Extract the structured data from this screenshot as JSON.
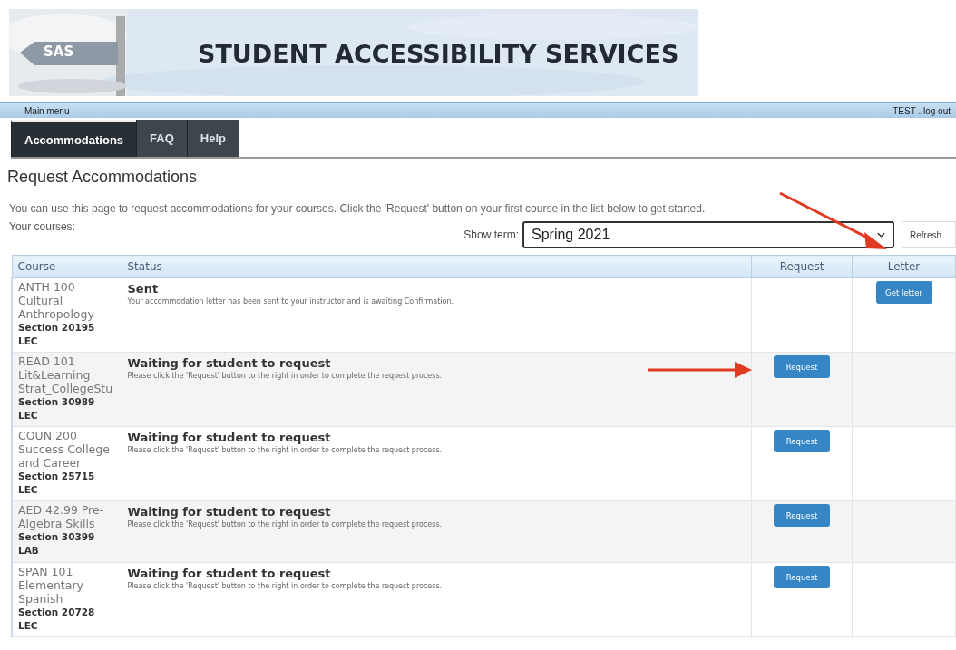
{
  "banner": {
    "logo": "SAS",
    "title": "STUDENT ACCESSIBILITY SERVICES"
  },
  "menu_bar": {
    "label": "Main menu",
    "user": "TEST",
    "separator": ".",
    "logout": "log out"
  },
  "tabs": [
    {
      "label": "Accommodations",
      "selected": true
    },
    {
      "label": "FAQ",
      "selected": false
    },
    {
      "label": "Help",
      "selected": false
    }
  ],
  "page_title": "Request Accommodations",
  "intro": "You can use this page to request accommodations for your courses. Click the 'Request' button on your first course in the list below to get started.",
  "courses_label": "Your courses:",
  "term": {
    "label": "Show term:",
    "value": "Spring 2021",
    "refresh": "Refresh"
  },
  "table": {
    "columns": [
      "Course",
      "Status",
      "Request",
      "Letter"
    ],
    "rows": [
      {
        "course": "ANTH 100 Cultural Anthropology",
        "section": "Section 20195",
        "type": "LEC",
        "status": "Sent",
        "message": "Your accommodation letter has been sent to your instructor and is awaiting Confirmation.",
        "letter_button": "Get letter"
      },
      {
        "course": "READ 101 Lit&Learning Strat_CollegeStu",
        "section": "Section 30989",
        "type": "LEC",
        "status": "Waiting for student to request",
        "message": "Please click the 'Request' button to the right in order to complete the request process.",
        "request_button": "Request",
        "arrow": true
      },
      {
        "course": "COUN 200 Success College and Career",
        "section": "Section 25715",
        "type": "LEC",
        "status": "Waiting for student to request",
        "message": "Please click the 'Request' button to the right in order to complete the request process.",
        "request_button": "Request"
      },
      {
        "course": "AED 42.99 Pre-Algebra Skills",
        "section": "Section 30399",
        "type": "LAB",
        "status": "Waiting for student to request",
        "message": "Please click the 'Request' button to the right in order to complete the request process.",
        "request_button": "Request"
      },
      {
        "course": "SPAN 101 Elementary Spanish",
        "section": "Section 20728",
        "type": "LEC",
        "status": "Waiting for student to request",
        "message": "Please click the 'Request' button to the right in order to complete the request process.",
        "request_button": "Request"
      }
    ]
  }
}
